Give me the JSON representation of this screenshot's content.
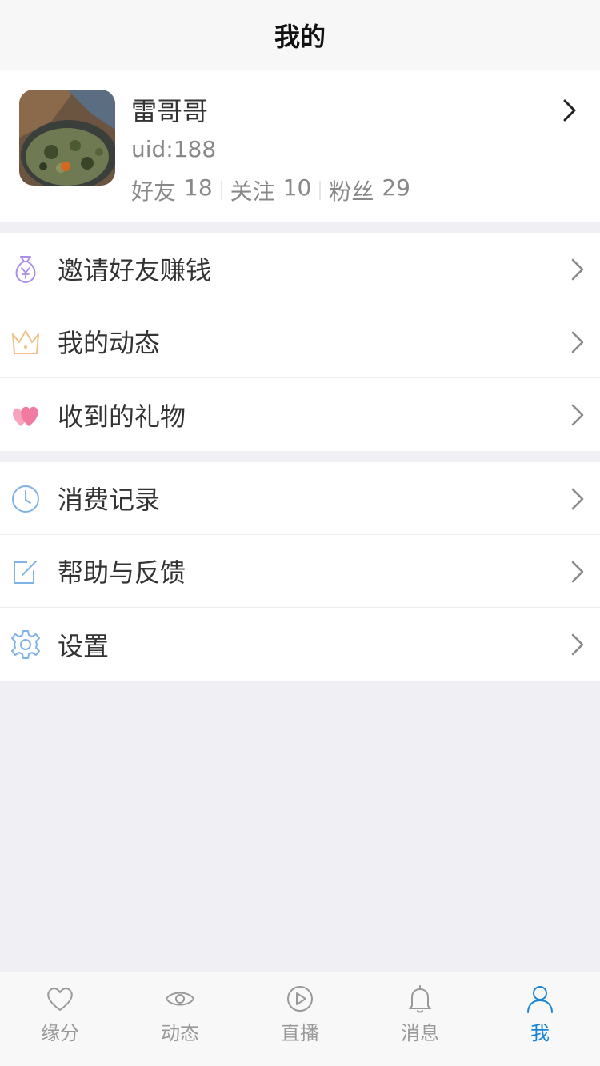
{
  "header": {
    "title": "我的"
  },
  "profile": {
    "name": "雷哥哥",
    "uid": "uid:188",
    "stats": [
      {
        "label": "好友",
        "value": "18"
      },
      {
        "label": "关注",
        "value": "10"
      },
      {
        "label": "粉丝",
        "value": "29"
      }
    ]
  },
  "menu_group_1": [
    {
      "label": "邀请好友赚钱",
      "icon": "money-bag-icon"
    },
    {
      "label": "我的动态",
      "icon": "crown-icon"
    },
    {
      "label": "收到的礼物",
      "icon": "hearts-icon"
    }
  ],
  "menu_group_2": [
    {
      "label": "消费记录",
      "icon": "clock-icon"
    },
    {
      "label": "帮助与反馈",
      "icon": "edit-icon"
    },
    {
      "label": "设置",
      "icon": "gear-icon"
    }
  ],
  "tabbar": {
    "items": [
      {
        "label": "缘分",
        "icon": "heart-icon"
      },
      {
        "label": "动态",
        "icon": "eye-icon"
      },
      {
        "label": "直播",
        "icon": "play-icon"
      },
      {
        "label": "消息",
        "icon": "bell-icon"
      },
      {
        "label": "我",
        "icon": "user-icon"
      }
    ],
    "active_index": 4
  },
  "colors": {
    "accent": "#1a85d6",
    "background": "#efeff4",
    "money_bag": "#a98fe8",
    "crown": "#f0c08a",
    "hearts": "#f07aa0",
    "clock": "#7fb2e5",
    "edit": "#7fb2e5",
    "gear": "#7fb2e5"
  }
}
